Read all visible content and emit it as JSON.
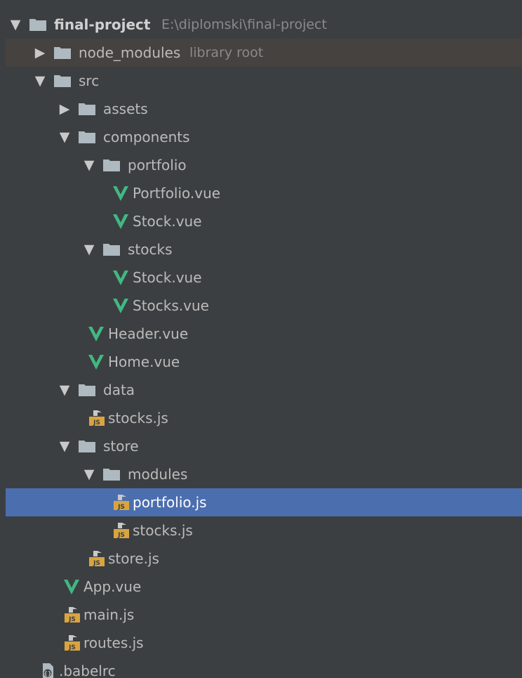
{
  "project": {
    "name": "final-project",
    "path": "E:\\diplomski\\final-project"
  },
  "nodes": [
    {
      "label": "node_modules",
      "hint": "library root"
    },
    {
      "label": "src"
    },
    {
      "label": "assets"
    },
    {
      "label": "components"
    },
    {
      "label": "portfolio"
    },
    {
      "label": "Portfolio.vue"
    },
    {
      "label": "Stock.vue"
    },
    {
      "label": "stocks"
    },
    {
      "label": "Stock.vue"
    },
    {
      "label": "Stocks.vue"
    },
    {
      "label": "Header.vue"
    },
    {
      "label": "Home.vue"
    },
    {
      "label": "data"
    },
    {
      "label": "stocks.js"
    },
    {
      "label": "store"
    },
    {
      "label": "modules"
    },
    {
      "label": "portfolio.js"
    },
    {
      "label": "stocks.js"
    },
    {
      "label": "store.js"
    },
    {
      "label": "App.vue"
    },
    {
      "label": "main.js"
    },
    {
      "label": "routes.js"
    },
    {
      "label": ".babelrc"
    }
  ],
  "icons": {
    "folder": "folder-icon",
    "vue": "vue-file-icon",
    "js": "js-file-icon",
    "config": "babelrc-config-icon",
    "expanded": "expand-arrow-icon",
    "collapsed": "collapse-arrow-icon"
  },
  "colors": {
    "background": "#3c3f41",
    "selection": "#4b6eaf",
    "library_row": "#45423f",
    "folder": "#aeb9c0",
    "vue_green": "#41b883",
    "js_yellow": "#d9a440"
  }
}
